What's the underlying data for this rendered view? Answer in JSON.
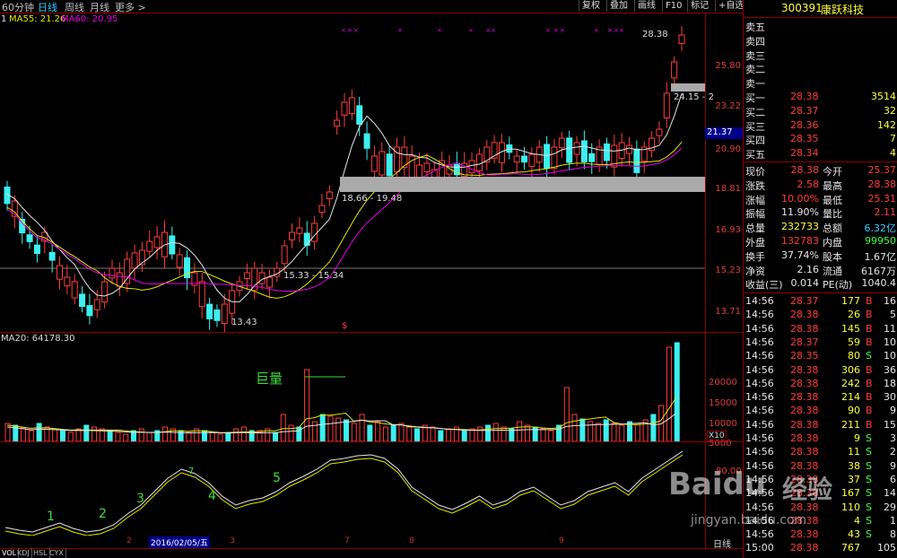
{
  "toolbar": {
    "tabs": [
      {
        "label": "60分钟",
        "active": false
      },
      {
        "label": "日线",
        "active": true
      },
      {
        "label": "周线",
        "active": false
      },
      {
        "label": "月线",
        "active": false
      },
      {
        "label": "更多 >",
        "active": false
      }
    ],
    "buttons": [
      "复权",
      "叠加",
      "画线",
      "F10",
      "标记",
      "+自选"
    ]
  },
  "stock": {
    "code": "300391",
    "name": "康跃科技"
  },
  "ma_legend": {
    "prefix": "1",
    "ma55": "MA55: 21.26",
    "ma60": "MA60: 20.95"
  },
  "price_axis": [
    "25.80",
    "23.22",
    "20.90",
    "18.81",
    "16.93",
    "15.23",
    "13.71"
  ],
  "current_price_marker": "21.37",
  "annotations": {
    "high": "28.38",
    "range_box_top": "24.15 - 2",
    "range_box_mid": "18.66 - 19.48",
    "range_box_low": "15.33 - 15.34",
    "low": "13.43",
    "dollar": "$",
    "volume_label": "巨量",
    "kdj_numbers": [
      "1",
      "2",
      "3",
      "4",
      "5",
      "7"
    ]
  },
  "volume": {
    "legend": "MA20: 64178.30",
    "axis": [
      "20000",
      "15000",
      "10000",
      "5000"
    ],
    "unit": "X10"
  },
  "indicator": {
    "axis": "80.00"
  },
  "x_axis": {
    "labels": [
      "2",
      "2016/02/05/五",
      "3",
      "7",
      "8",
      "9"
    ],
    "period": "日线"
  },
  "bottom_tabs": [
    "VOL",
    "KDJ",
    "HSL",
    "CYX"
  ],
  "order_book": {
    "asks": [
      {
        "label": "卖五",
        "price": "",
        "vol": ""
      },
      {
        "label": "卖四",
        "price": "",
        "vol": ""
      },
      {
        "label": "卖三",
        "price": "",
        "vol": ""
      },
      {
        "label": "卖二",
        "price": "",
        "vol": ""
      },
      {
        "label": "卖一",
        "price": "",
        "vol": ""
      }
    ],
    "bids": [
      {
        "label": "买一",
        "price": "28.38",
        "vol": "3514"
      },
      {
        "label": "买二",
        "price": "28.37",
        "vol": "32"
      },
      {
        "label": "买三",
        "price": "28.36",
        "vol": "142"
      },
      {
        "label": "买四",
        "price": "28.35",
        "vol": "7"
      },
      {
        "label": "买五",
        "price": "28.34",
        "vol": "4"
      }
    ]
  },
  "stats": [
    {
      "l1": "现价",
      "v1": "28.38",
      "c1": "red",
      "l2": "今开",
      "v2": "25.37",
      "c2": "red"
    },
    {
      "l1": "涨跌",
      "v1": "2.58",
      "c1": "red",
      "l2": "最高",
      "v2": "28.38",
      "c2": "red"
    },
    {
      "l1": "涨幅",
      "v1": "10.00%",
      "c1": "red",
      "l2": "最低",
      "v2": "25.31",
      "c2": "red"
    },
    {
      "l1": "振幅",
      "v1": "11.90%",
      "c1": "white",
      "l2": "量比",
      "v2": "2.11",
      "c2": "red"
    },
    {
      "l1": "总量",
      "v1": "232733",
      "c1": "yellow",
      "l2": "总额",
      "v2": "6.32亿",
      "c2": "cyan"
    },
    {
      "l1": "外盘",
      "v1": "132783",
      "c1": "red",
      "l2": "内盘",
      "v2": "99950",
      "c2": "green"
    },
    {
      "l1": "换手",
      "v1": "37.74%",
      "c1": "white",
      "l2": "股本",
      "v2": "1.67亿",
      "c2": "white"
    },
    {
      "l1": "净资",
      "v1": "2.16",
      "c1": "white",
      "l2": "流通",
      "v2": "6167万",
      "c2": "white"
    },
    {
      "l1": "收益(三)",
      "v1": "0.014",
      "c1": "white",
      "l2": "PE(动)",
      "v2": "1040.4",
      "c2": "white"
    }
  ],
  "ticks": [
    {
      "time": "14:56",
      "price": "28.37",
      "vol": "177",
      "side": "B",
      "n": "16"
    },
    {
      "time": "14:56",
      "price": "28.38",
      "vol": "26",
      "side": "B",
      "n": "5"
    },
    {
      "time": "14:56",
      "price": "28.38",
      "vol": "145",
      "side": "B",
      "n": "11"
    },
    {
      "time": "14:56",
      "price": "28.37",
      "vol": "59",
      "side": "B",
      "n": "10"
    },
    {
      "time": "14:56",
      "price": "28.35",
      "vol": "80",
      "side": "S",
      "n": "10"
    },
    {
      "time": "14:56",
      "price": "28.38",
      "vol": "306",
      "side": "B",
      "n": "36"
    },
    {
      "time": "14:56",
      "price": "28.38",
      "vol": "242",
      "side": "B",
      "n": "18"
    },
    {
      "time": "14:56",
      "price": "28.38",
      "vol": "214",
      "side": "B",
      "n": "30"
    },
    {
      "time": "14:56",
      "price": "28.38",
      "vol": "90",
      "side": "B",
      "n": "9"
    },
    {
      "time": "14:56",
      "price": "28.38",
      "vol": "211",
      "side": "B",
      "n": "15"
    },
    {
      "time": "14:56",
      "price": "28.38",
      "vol": "9",
      "side": "S",
      "n": "3"
    },
    {
      "time": "14:56",
      "price": "28.38",
      "vol": "11",
      "side": "S",
      "n": "2"
    },
    {
      "time": "14:56",
      "price": "28.38",
      "vol": "38",
      "side": "S",
      "n": "9"
    },
    {
      "time": "14:56",
      "price": "28.38",
      "vol": "37",
      "side": "S",
      "n": "6"
    },
    {
      "time": "14:56",
      "price": "28.38",
      "vol": "167",
      "side": "S",
      "n": "14"
    },
    {
      "time": "14:56",
      "price": "28.38",
      "vol": "110",
      "side": "S",
      "n": "29"
    },
    {
      "time": "14:56",
      "price": "28.38",
      "vol": "4",
      "side": "S",
      "n": "1"
    },
    {
      "time": "14:56",
      "price": "28.38",
      "vol": "43",
      "side": "S",
      "n": "8"
    },
    {
      "time": "15:00",
      "price": "28.38",
      "vol": "767",
      "side": "",
      "n": "105"
    }
  ],
  "watermark": {
    "brand": "Baidu",
    "text": "经验",
    "url": "jingyan.baidu.com"
  },
  "colors": {
    "up": "#ff3c3c",
    "down": "#3cf0f0",
    "ma_white": "#e6e6e6",
    "ma_yellow": "#e6e600",
    "ma_magenta": "#e600e6",
    "grid": "#8b0000"
  }
}
